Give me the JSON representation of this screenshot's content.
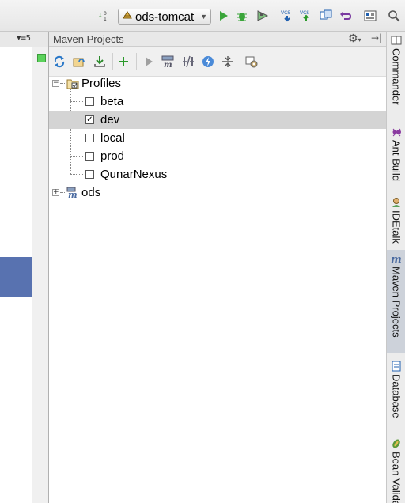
{
  "toolbar": {
    "run_config": "ods-tomcat",
    "icons": [
      "sort-icon",
      "tomcat-icon",
      "run-icon",
      "debug-icon",
      "coverage-icon",
      "vcs-update-icon",
      "vcs-commit-icon",
      "vcs-compare-icon",
      "vcs-revert-icon",
      "project-structure-icon",
      "search-icon"
    ]
  },
  "editor_strip": {
    "header_menu": "▾≡5"
  },
  "maven": {
    "title": "Maven Projects",
    "toolbar_icons": [
      "reimport-icon",
      "generate-sources-icon",
      "download-icon",
      "add-icon",
      "run-goal-icon",
      "execute-maven-icon",
      "toggle-offline-icon",
      "skip-tests-icon",
      "collapse-all-icon",
      "settings-icon"
    ],
    "tree": {
      "profiles_label": "Profiles",
      "profiles": [
        {
          "label": "beta",
          "checked": false,
          "selected": false
        },
        {
          "label": "dev",
          "checked": true,
          "selected": true
        },
        {
          "label": "local",
          "checked": false,
          "selected": false
        },
        {
          "label": "prod",
          "checked": false,
          "selected": false
        },
        {
          "label": "QunarNexus",
          "checked": false,
          "selected": false
        }
      ],
      "project_label": "ods"
    }
  },
  "side_tabs": [
    {
      "label": "Commander",
      "icon": "commander-icon",
      "active": false
    },
    {
      "label": "Ant Build",
      "icon": "ant-icon",
      "active": false
    },
    {
      "label": "IDEtalk",
      "icon": "idetalk-icon",
      "active": false
    },
    {
      "label": "Maven Projects",
      "icon": "maven-icon",
      "active": true
    },
    {
      "label": "Database",
      "icon": "database-icon",
      "active": false
    },
    {
      "label": "Bean Valida",
      "icon": "bean-icon",
      "active": false
    }
  ],
  "colors": {
    "accent_selection": "#5872b0",
    "tree_selected_row": "#d4d4d4",
    "active_side_tab": "#cdd2da"
  }
}
